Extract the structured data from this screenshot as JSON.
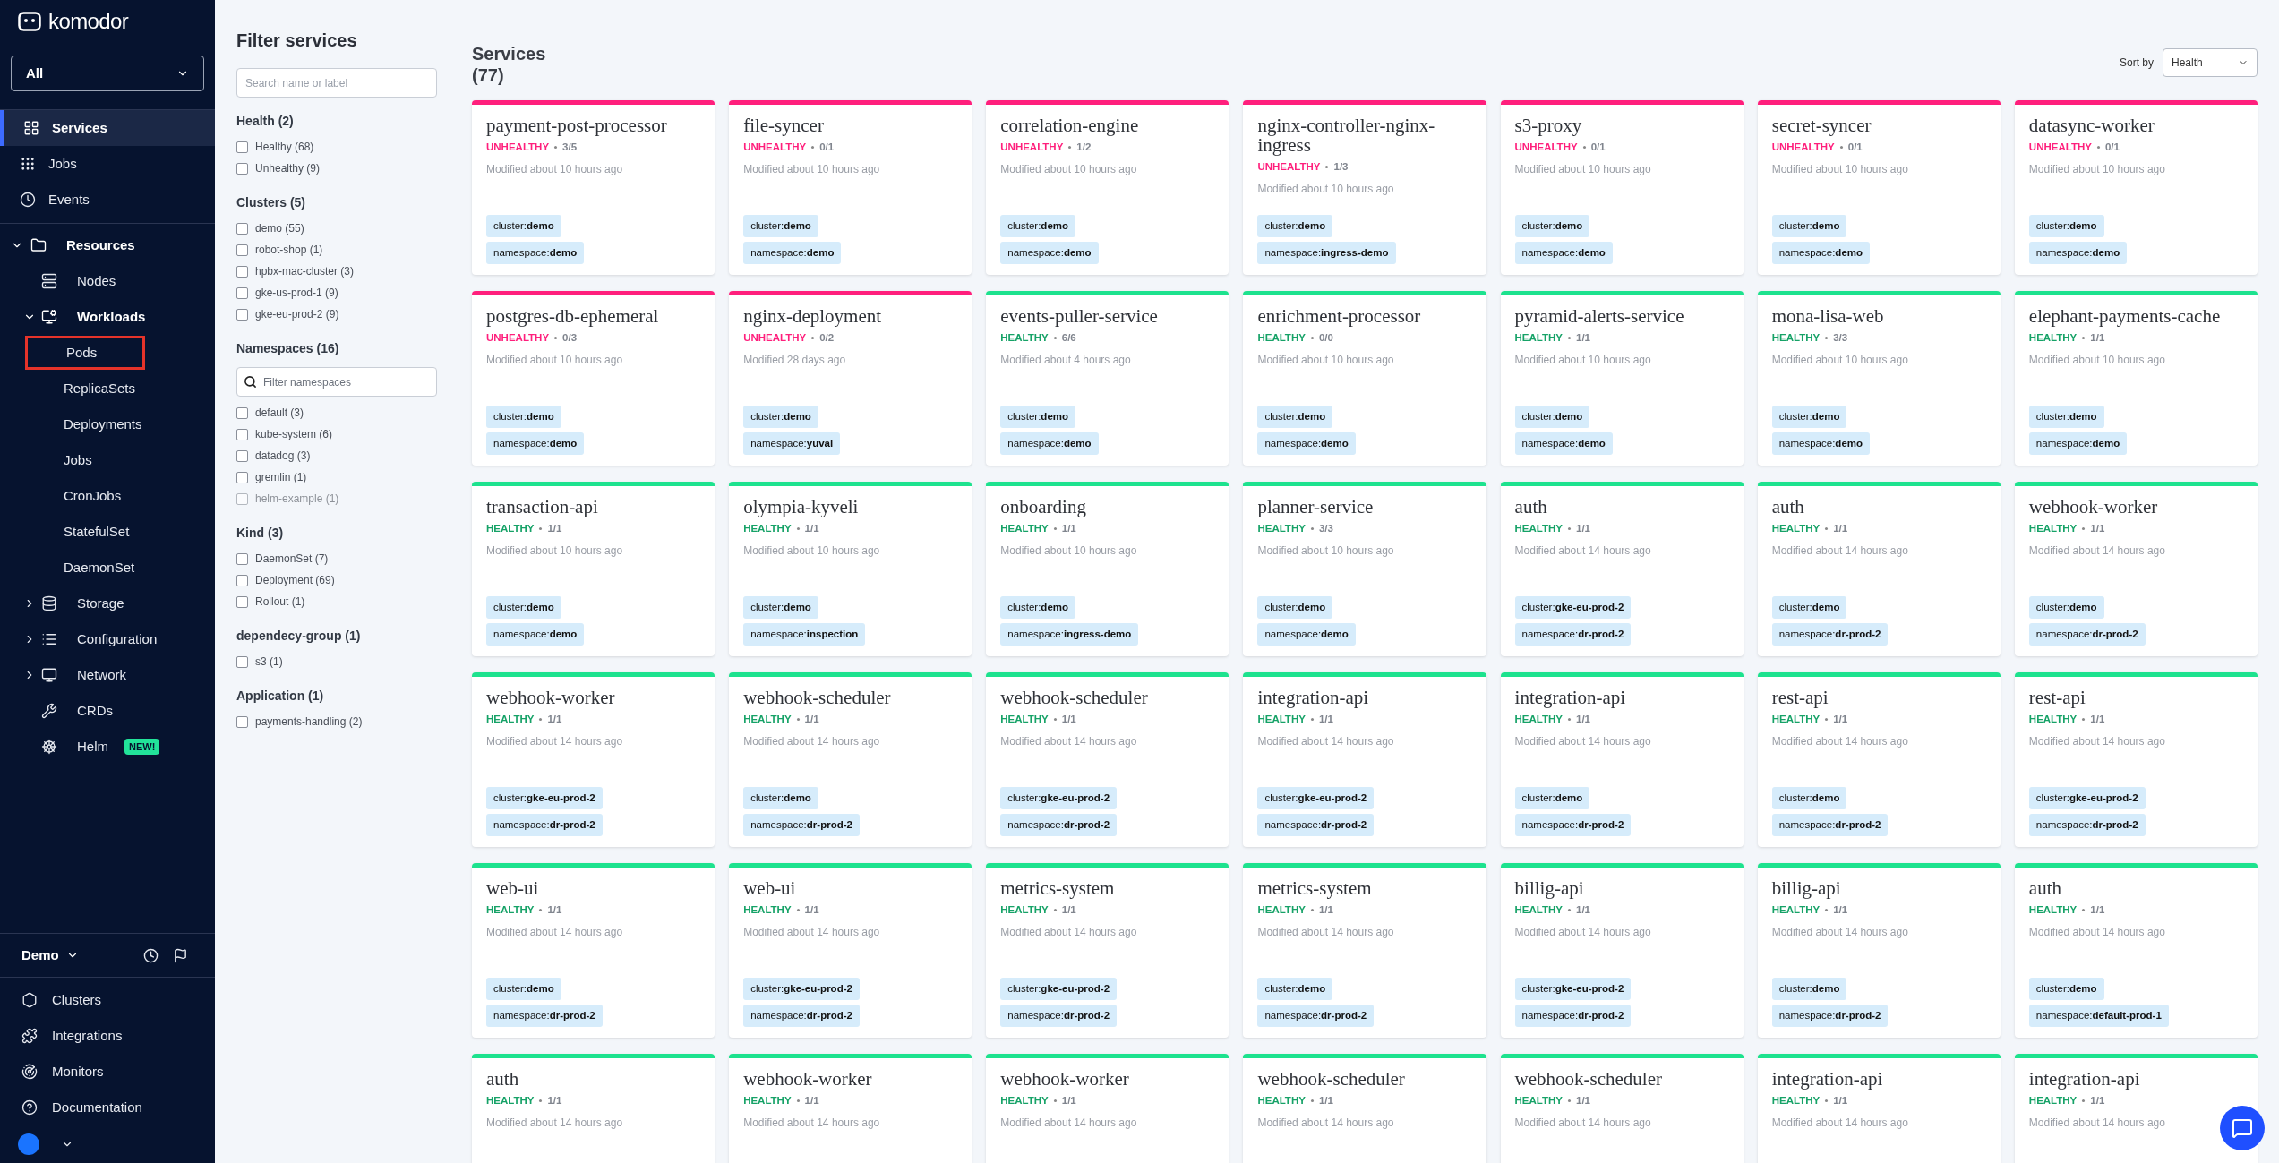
{
  "sidebar": {
    "logo": "komodor",
    "workspace_select": "All",
    "top_items": [
      {
        "label": "Services",
        "selected": true
      },
      {
        "label": "Jobs",
        "selected": false
      },
      {
        "label": "Events",
        "selected": false
      }
    ],
    "resources": {
      "label": "Resources",
      "expanded": true,
      "children": [
        {
          "label": "Nodes"
        },
        {
          "label": "Workloads",
          "expanded": true,
          "children": [
            {
              "label": "Pods",
              "outlined": true
            },
            {
              "label": "ReplicaSets",
              "outlined": false
            },
            {
              "label": "Deployments",
              "outlined": false
            },
            {
              "label": "Jobs",
              "outlined": false
            },
            {
              "label": "CronJobs",
              "outlined": false
            },
            {
              "label": "StatefulSet",
              "outlined": false
            },
            {
              "label": "DaemonSet",
              "outlined": false
            }
          ]
        },
        {
          "label": "Storage",
          "expanded": false
        },
        {
          "label": "Configuration",
          "expanded": false
        },
        {
          "label": "Network",
          "expanded": false
        },
        {
          "label": "CRDs"
        },
        {
          "label": "Helm",
          "badge": "NEW!"
        }
      ]
    },
    "environment": "Demo",
    "bottom_items": [
      {
        "label": "Clusters"
      },
      {
        "label": "Integrations"
      },
      {
        "label": "Monitors"
      },
      {
        "label": "Documentation"
      }
    ]
  },
  "filters": {
    "title": "Filter services",
    "search_placeholder": "Search name or label",
    "groups": [
      {
        "title": "Health (2)",
        "options": [
          {
            "label": "Healthy (68)",
            "checked": false
          },
          {
            "label": "Unhealthy (9)",
            "checked": false
          }
        ]
      },
      {
        "title": "Clusters (5)",
        "options": [
          {
            "label": "demo (55)",
            "checked": false
          },
          {
            "label": "robot-shop (1)",
            "checked": false
          },
          {
            "label": "hpbx-mac-cluster (3)",
            "checked": false
          },
          {
            "label": "gke-us-prod-1 (9)",
            "checked": false
          },
          {
            "label": "gke-eu-prod-2 (9)",
            "checked": false
          }
        ]
      },
      {
        "title": "Namespaces (16)",
        "placeholder": "Filter namespaces",
        "options": [
          {
            "label": "default (3)",
            "checked": false,
            "faded": false
          },
          {
            "label": "kube-system (6)",
            "checked": false,
            "faded": false
          },
          {
            "label": "datadog (3)",
            "checked": false,
            "faded": false
          },
          {
            "label": "gremlin (1)",
            "checked": false,
            "faded": false
          },
          {
            "label": "helm-example (1)",
            "checked": false,
            "faded": true
          }
        ]
      },
      {
        "title": "Kind (3)",
        "options": [
          {
            "label": "DaemonSet (7)",
            "checked": false
          },
          {
            "label": "Deployment (69)",
            "checked": false
          },
          {
            "label": "Rollout (1)",
            "checked": false
          }
        ]
      },
      {
        "title": "dependecy-group (1)",
        "options": [
          {
            "label": "s3 (1)",
            "checked": false
          }
        ]
      },
      {
        "title": "Application (1)",
        "options": [
          {
            "label": "payments-handling (2)",
            "checked": false
          }
        ]
      }
    ]
  },
  "main": {
    "title": "Services",
    "count": "(77)",
    "sort": {
      "label": "Sort by",
      "value": "Health"
    },
    "cards": [
      {
        "name": "payment-post-processor",
        "healthy": false,
        "status": "UNHEALTHY",
        "pods": "3/5",
        "modified": "Modified about 10 hours ago",
        "tags": [
          "cluster:**demo**",
          "namespace:**demo**"
        ]
      },
      {
        "name": "file-syncer",
        "healthy": false,
        "status": "UNHEALTHY",
        "pods": "0/1",
        "modified": "Modified about 10 hours ago",
        "tags": [
          "cluster:**demo**",
          "namespace:**demo**"
        ]
      },
      {
        "name": "correlation-engine",
        "healthy": false,
        "status": "UNHEALTHY",
        "pods": "1/2",
        "modified": "Modified about 10 hours ago",
        "tags": [
          "cluster:**demo**",
          "namespace:**demo**"
        ]
      },
      {
        "name": "nginx-controller-nginx-ingress",
        "healthy": false,
        "status": "UNHEALTHY",
        "pods": "1/3",
        "modified": "Modified about 10 hours ago",
        "tags": [
          "cluster:**demo**",
          "namespace:**ingress-demo**"
        ]
      },
      {
        "name": "s3-proxy",
        "healthy": false,
        "status": "UNHEALTHY",
        "pods": "0/1",
        "modified": "Modified about 10 hours ago",
        "tags": [
          "cluster:**demo**",
          "namespace:**demo**"
        ]
      },
      {
        "name": "secret-syncer",
        "healthy": false,
        "status": "UNHEALTHY",
        "pods": "0/1",
        "modified": "Modified about 10 hours ago",
        "tags": [
          "cluster:**demo**",
          "namespace:**demo**"
        ]
      },
      {
        "name": "datasync-worker",
        "healthy": false,
        "status": "UNHEALTHY",
        "pods": "0/1",
        "modified": "Modified about 10 hours ago",
        "tags": [
          "cluster:**demo**",
          "namespace:**demo**"
        ]
      },
      {
        "name": "postgres-db-ephemeral",
        "healthy": false,
        "status": "UNHEALTHY",
        "pods": "0/3",
        "modified": "Modified about 10 hours ago",
        "tags": [
          "cluster:**demo**",
          "namespace:**demo**"
        ]
      },
      {
        "name": "nginx-deployment",
        "healthy": false,
        "status": "UNHEALTHY",
        "pods": "0/2",
        "modified": "Modified 28 days ago",
        "tags": [
          "cluster:**demo**",
          "namespace:**yuval**"
        ]
      },
      {
        "name": "events-puller-service",
        "healthy": true,
        "status": "HEALTHY",
        "pods": "6/6",
        "modified": "Modified about 4 hours ago",
        "tags": [
          "cluster:**demo**",
          "namespace:**demo**"
        ]
      },
      {
        "name": "enrichment-processor",
        "healthy": true,
        "status": "HEALTHY",
        "pods": "0/0",
        "modified": "Modified about 10 hours ago",
        "tags": [
          "cluster:**demo**",
          "namespace:**demo**"
        ]
      },
      {
        "name": "pyramid-alerts-service",
        "healthy": true,
        "status": "HEALTHY",
        "pods": "1/1",
        "modified": "Modified about 10 hours ago",
        "tags": [
          "cluster:**demo**",
          "namespace:**demo**"
        ]
      },
      {
        "name": "mona-lisa-web",
        "healthy": true,
        "status": "HEALTHY",
        "pods": "3/3",
        "modified": "Modified about 10 hours ago",
        "tags": [
          "cluster:**demo**",
          "namespace:**demo**"
        ]
      },
      {
        "name": "elephant-payments-cache",
        "healthy": true,
        "status": "HEALTHY",
        "pods": "1/1",
        "modified": "Modified about 10 hours ago",
        "tags": [
          "cluster:**demo**",
          "namespace:**demo**"
        ]
      },
      {
        "name": "transaction-api",
        "healthy": true,
        "status": "HEALTHY",
        "pods": "1/1",
        "modified": "Modified about 10 hours ago",
        "tags": [
          "cluster:**demo**",
          "namespace:**demo**"
        ]
      },
      {
        "name": "olympia-kyveli",
        "healthy": true,
        "status": "HEALTHY",
        "pods": "1/1",
        "modified": "Modified about 10 hours ago",
        "tags": [
          "cluster:**demo**",
          "namespace:**inspection**"
        ]
      },
      {
        "name": "onboarding",
        "healthy": true,
        "status": "HEALTHY",
        "pods": "1/1",
        "modified": "Modified about 10 hours ago",
        "tags": [
          "cluster:**demo**",
          "namespace:**ingress-demo**"
        ]
      },
      {
        "name": "planner-service",
        "healthy": true,
        "status": "HEALTHY",
        "pods": "3/3",
        "modified": "Modified about 10 hours ago",
        "tags": [
          "cluster:**demo**",
          "namespace:**demo**"
        ]
      },
      {
        "name": "auth",
        "healthy": true,
        "status": "HEALTHY",
        "pods": "1/1",
        "modified": "Modified about 14 hours ago",
        "tags": [
          "cluster:**gke-eu-prod-2**",
          "namespace:**dr-prod-2**"
        ]
      },
      {
        "name": "auth",
        "healthy": true,
        "status": "HEALTHY",
        "pods": "1/1",
        "modified": "Modified about 14 hours ago",
        "tags": [
          "cluster:**demo**",
          "namespace:**dr-prod-2**"
        ]
      },
      {
        "name": "webhook-worker",
        "healthy": true,
        "status": "HEALTHY",
        "pods": "1/1",
        "modified": "Modified about 14 hours ago",
        "tags": [
          "cluster:**demo**",
          "namespace:**dr-prod-2**"
        ]
      },
      {
        "name": "webhook-worker",
        "healthy": true,
        "status": "HEALTHY",
        "pods": "1/1",
        "modified": "Modified about 14 hours ago",
        "tags": [
          "cluster:**gke-eu-prod-2**",
          "namespace:**dr-prod-2**"
        ]
      },
      {
        "name": "webhook-scheduler",
        "healthy": true,
        "status": "HEALTHY",
        "pods": "1/1",
        "modified": "Modified about 14 hours ago",
        "tags": [
          "cluster:**demo**",
          "namespace:**dr-prod-2**"
        ]
      },
      {
        "name": "webhook-scheduler",
        "healthy": true,
        "status": "HEALTHY",
        "pods": "1/1",
        "modified": "Modified about 14 hours ago",
        "tags": [
          "cluster:**gke-eu-prod-2**",
          "namespace:**dr-prod-2**"
        ]
      },
      {
        "name": "integration-api",
        "healthy": true,
        "status": "HEALTHY",
        "pods": "1/1",
        "modified": "Modified about 14 hours ago",
        "tags": [
          "cluster:**gke-eu-prod-2**",
          "namespace:**dr-prod-2**"
        ]
      },
      {
        "name": "integration-api",
        "healthy": true,
        "status": "HEALTHY",
        "pods": "1/1",
        "modified": "Modified about 14 hours ago",
        "tags": [
          "cluster:**demo**",
          "namespace:**dr-prod-2**"
        ]
      },
      {
        "name": "rest-api",
        "healthy": true,
        "status": "HEALTHY",
        "pods": "1/1",
        "modified": "Modified about 14 hours ago",
        "tags": [
          "cluster:**demo**",
          "namespace:**dr-prod-2**"
        ]
      },
      {
        "name": "rest-api",
        "healthy": true,
        "status": "HEALTHY",
        "pods": "1/1",
        "modified": "Modified about 14 hours ago",
        "tags": [
          "cluster:**gke-eu-prod-2**",
          "namespace:**dr-prod-2**"
        ]
      },
      {
        "name": "web-ui",
        "healthy": true,
        "status": "HEALTHY",
        "pods": "1/1",
        "modified": "Modified about 14 hours ago",
        "tags": [
          "cluster:**demo**",
          "namespace:**dr-prod-2**"
        ]
      },
      {
        "name": "web-ui",
        "healthy": true,
        "status": "HEALTHY",
        "pods": "1/1",
        "modified": "Modified about 14 hours ago",
        "tags": [
          "cluster:**gke-eu-prod-2**",
          "namespace:**dr-prod-2**"
        ]
      },
      {
        "name": "metrics-system",
        "healthy": true,
        "status": "HEALTHY",
        "pods": "1/1",
        "modified": "Modified about 14 hours ago",
        "tags": [
          "cluster:**gke-eu-prod-2**",
          "namespace:**dr-prod-2**"
        ]
      },
      {
        "name": "metrics-system",
        "healthy": true,
        "status": "HEALTHY",
        "pods": "1/1",
        "modified": "Modified about 14 hours ago",
        "tags": [
          "cluster:**demo**",
          "namespace:**dr-prod-2**"
        ]
      },
      {
        "name": "billig-api",
        "healthy": true,
        "status": "HEALTHY",
        "pods": "1/1",
        "modified": "Modified about 14 hours ago",
        "tags": [
          "cluster:**gke-eu-prod-2**",
          "namespace:**dr-prod-2**"
        ]
      },
      {
        "name": "billig-api",
        "healthy": true,
        "status": "HEALTHY",
        "pods": "1/1",
        "modified": "Modified about 14 hours ago",
        "tags": [
          "cluster:**demo**",
          "namespace:**dr-prod-2**"
        ]
      },
      {
        "name": "auth",
        "healthy": true,
        "status": "HEALTHY",
        "pods": "1/1",
        "modified": "Modified about 14 hours ago",
        "tags": [
          "cluster:**demo**",
          "namespace:**default-prod-1**"
        ]
      },
      {
        "name": "auth",
        "healthy": true,
        "status": "HEALTHY",
        "pods": "1/1",
        "modified": "Modified about 14 hours ago"
      },
      {
        "name": "webhook-worker",
        "healthy": true,
        "status": "HEALTHY",
        "pods": "1/1",
        "modified": "Modified about 14 hours ago"
      },
      {
        "name": "webhook-worker",
        "healthy": true,
        "status": "HEALTHY",
        "pods": "1/1",
        "modified": "Modified about 14 hours ago"
      },
      {
        "name": "webhook-scheduler",
        "healthy": true,
        "status": "HEALTHY",
        "pods": "1/1",
        "modified": "Modified about 14 hours ago"
      },
      {
        "name": "webhook-scheduler",
        "healthy": true,
        "status": "HEALTHY",
        "pods": "1/1",
        "modified": "Modified about 14 hours ago"
      },
      {
        "name": "integration-api",
        "healthy": true,
        "status": "HEALTHY",
        "pods": "1/1",
        "modified": "Modified about 14 hours ago"
      },
      {
        "name": "integration-api",
        "healthy": true,
        "status": "HEALTHY",
        "pods": "1/1",
        "modified": "Modified about 14 hours ago"
      }
    ]
  }
}
